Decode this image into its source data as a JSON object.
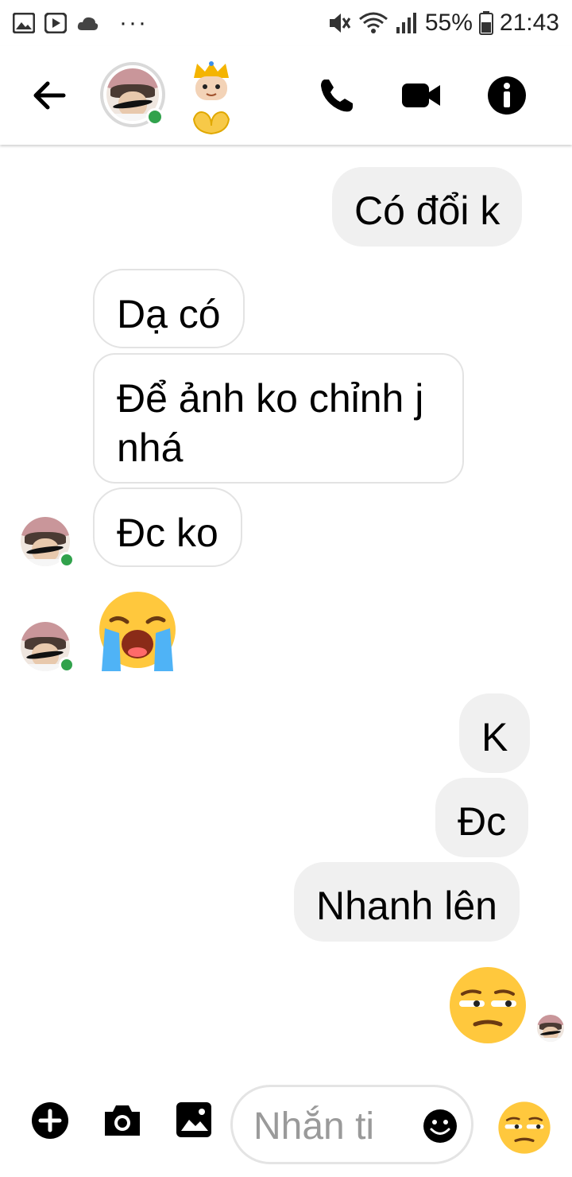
{
  "status_bar": {
    "battery": "55%",
    "time": "21:43",
    "dots": "···"
  },
  "header": {
    "back_icon": "arrow-left-icon",
    "call_icon": "phone-icon",
    "video_icon": "video-camera-icon",
    "info_icon": "info-icon",
    "emoji": "crowned-face-heart-hands"
  },
  "messages": [
    {
      "side": "out",
      "text": "Có đổi k"
    },
    {
      "side": "in",
      "text": "Dạ có"
    },
    {
      "side": "in",
      "text": "Để ảnh ko chỉnh j\nnhá"
    },
    {
      "side": "in",
      "text": "Đc ko"
    },
    {
      "side": "in",
      "emoji": "loudly-crying-face"
    },
    {
      "side": "out",
      "text": "K"
    },
    {
      "side": "out",
      "text": "Đc"
    },
    {
      "side": "out",
      "text": "Nhanh lên"
    },
    {
      "side": "out",
      "emoji": "unamused-face"
    }
  ],
  "composer": {
    "placeholder": "Nhắn ti",
    "quick_reaction": "unamused-face"
  },
  "colors": {
    "online": "#31a24c",
    "outgoing_bubble": "#f0f0f0",
    "incoming_border": "#e3e3e3",
    "emoji_yellow": "#ffc83d"
  }
}
